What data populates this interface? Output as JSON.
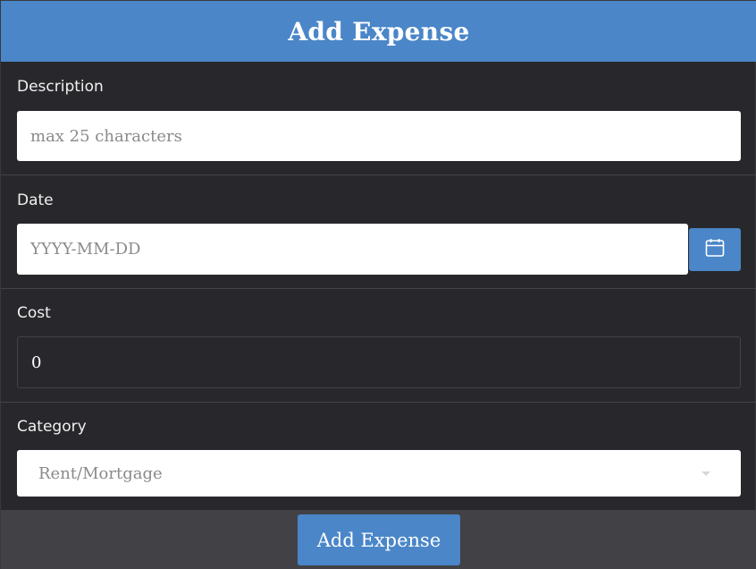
{
  "header": {
    "title": "Add Expense"
  },
  "form": {
    "description": {
      "label": "Description",
      "placeholder": "max 25 characters",
      "value": ""
    },
    "date": {
      "label": "Date",
      "placeholder": "YYYY-MM-DD",
      "value": "",
      "picker_icon": "calendar-icon"
    },
    "cost": {
      "label": "Cost",
      "value": "0"
    },
    "category": {
      "label": "Category",
      "selected": "Rent/Mortgage",
      "icon": "chevron-down-icon"
    }
  },
  "footer": {
    "submit_label": "Add Expense"
  },
  "colors": {
    "accent": "#4a86c8",
    "background": "#28282c",
    "footer": "#424246"
  }
}
